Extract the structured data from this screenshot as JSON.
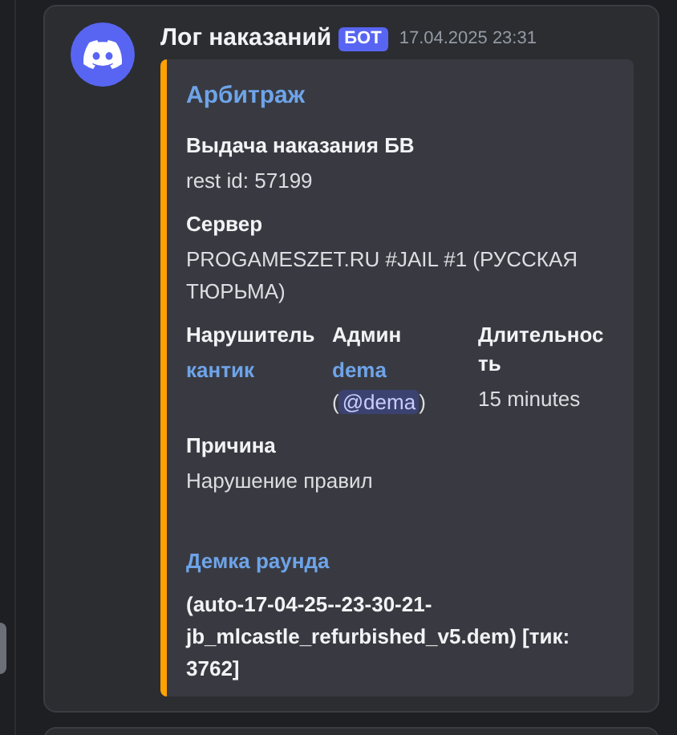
{
  "message": {
    "author": "Лог наказаний",
    "badge": "БОТ",
    "timestamp": "17.04.2025 23:31"
  },
  "embed": {
    "color": "#ffa200",
    "title": "Арбитраж",
    "fields": [
      {
        "name": "Выдача наказания БВ",
        "inline": false,
        "value": [
          {
            "kind": "text",
            "text": "rest id: 57199"
          }
        ]
      },
      {
        "name": "Сервер",
        "inline": false,
        "value": [
          {
            "kind": "text",
            "text": "PROGAMESZET.RU #JAIL #1 (РУССКАЯ ТЮРЬМА)"
          }
        ]
      },
      {
        "name": "Нарушитель",
        "inline": true,
        "value": [
          {
            "kind": "link",
            "text": "кантик"
          }
        ]
      },
      {
        "name": "Админ",
        "inline": true,
        "value": [
          {
            "kind": "link",
            "text": "dema"
          },
          {
            "kind": "text",
            "text": "("
          },
          {
            "kind": "mention",
            "text": "@dema"
          },
          {
            "kind": "text",
            "text": ")"
          }
        ]
      },
      {
        "name": "Длительность",
        "inline": true,
        "value": [
          {
            "kind": "text",
            "text": "15 minutes"
          }
        ]
      },
      {
        "name": "Причина",
        "inline": false,
        "value": [
          {
            "kind": "text",
            "text": "Нарушение правил"
          }
        ]
      }
    ],
    "link_title": "Демка раунда",
    "link_body": "(auto-17-04-25--23-30-21-jb_mlcastle_refurbished_v5.dem) [тик: 3762]"
  }
}
